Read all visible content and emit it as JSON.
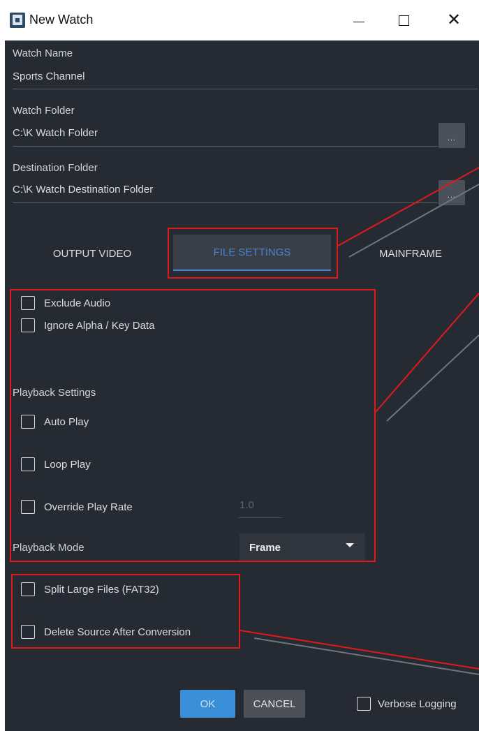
{
  "window": {
    "title": "New Watch",
    "minimize_glyph": "—",
    "close_glyph": "✕"
  },
  "fields": {
    "watch_name": {
      "label": "Watch Name",
      "value": "Sports Channel"
    },
    "watch_folder": {
      "label": "Watch Folder",
      "value": "C:\\K Watch Folder",
      "browse_label": "..."
    },
    "destination_folder": {
      "label": "Destination Folder",
      "value": "C:\\K Watch Destination Folder",
      "browse_label": "..."
    }
  },
  "tabs": [
    {
      "label": "OUTPUT VIDEO",
      "active": false
    },
    {
      "label": "FILE SETTINGS",
      "active": true
    },
    {
      "label": "MAINFRAME",
      "active": false
    }
  ],
  "file_settings": {
    "exclude_audio": {
      "label": "Exclude Audio",
      "checked": false
    },
    "ignore_alpha": {
      "label": "Ignore Alpha / Key Data",
      "checked": false
    },
    "playback_settings_label": "Playback Settings",
    "auto_play": {
      "label": "Auto Play",
      "checked": false
    },
    "loop_play": {
      "label": "Loop Play",
      "checked": false
    },
    "override_play_rate": {
      "label": "Override Play Rate",
      "checked": false,
      "rate_value": "1.0"
    },
    "playback_mode": {
      "label": "Playback Mode",
      "selected": "Frame"
    },
    "split_large_files": {
      "label": "Split Large Files (FAT32)",
      "checked": false
    },
    "delete_source": {
      "label": "Delete Source After Conversion",
      "checked": false
    }
  },
  "footer": {
    "ok_label": "OK",
    "cancel_label": "CANCEL",
    "verbose_logging": {
      "label": "Verbose Logging",
      "checked": false
    }
  },
  "colors": {
    "panel_bg": "#262b33",
    "accent": "#4a82d4",
    "ok_button": "#3b8fd8",
    "annotation": "#e01a1a"
  },
  "icons": {
    "app": "new-watch-app-icon",
    "minimize": "minimize-icon",
    "maximize": "maximize-icon",
    "close": "close-icon",
    "dropdown": "chevron-down-icon"
  }
}
